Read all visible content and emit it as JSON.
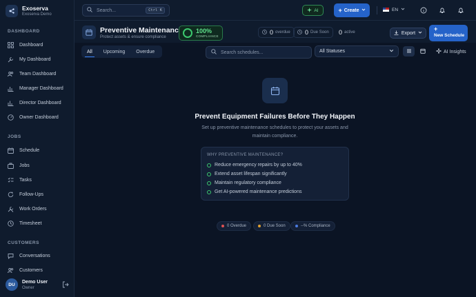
{
  "brand": {
    "name": "Exoserva",
    "subtitle": "Exoserva Demo"
  },
  "sidebar": {
    "sections": [
      {
        "label": "DASHBOARD",
        "items": [
          {
            "label": "Dashboard",
            "icon": "grid-icon"
          },
          {
            "label": "My Dashboard",
            "icon": "wrench-icon"
          },
          {
            "label": "Team Dashboard",
            "icon": "users-icon"
          },
          {
            "label": "Manager Dashboard",
            "icon": "bar-chart-icon"
          },
          {
            "label": "Director Dashboard",
            "icon": "bar-chart-icon"
          },
          {
            "label": "Owner Dashboard",
            "icon": "gauge-icon"
          }
        ]
      },
      {
        "label": "JOBS",
        "items": [
          {
            "label": "Schedule",
            "icon": "calendar-icon"
          },
          {
            "label": "Jobs",
            "icon": "briefcase-icon"
          },
          {
            "label": "Tasks",
            "icon": "tasks-icon"
          },
          {
            "label": "Follow-Ups",
            "icon": "refresh-icon"
          },
          {
            "label": "Work Orders",
            "icon": "wrench-icon"
          },
          {
            "label": "Timesheet",
            "icon": "clock-icon"
          }
        ]
      },
      {
        "label": "CUSTOMERS",
        "items": [
          {
            "label": "Conversations",
            "icon": "chat-icon"
          },
          {
            "label": "Customers",
            "icon": "users-icon"
          }
        ]
      }
    ]
  },
  "user": {
    "initials": "DU",
    "name": "Demo User",
    "role": "Owner"
  },
  "topbar": {
    "search_placeholder": "Search...",
    "search_shortcut": "Ctrl K",
    "ai_label": "AI",
    "create_label": "Create",
    "language": "EN"
  },
  "page": {
    "title": "Preventive Maintenance",
    "subtitle": "Protect assets & ensure compliance",
    "compliance_value": "100%",
    "compliance_label": "COMPLIANCE",
    "stats": [
      {
        "value": "0",
        "label": "overdue"
      },
      {
        "value": "0",
        "label": "Due Soon"
      },
      {
        "value": "0",
        "label": "active"
      }
    ],
    "export_label": "Export",
    "new_label": "New Schedule"
  },
  "filters": {
    "tabs": [
      "All",
      "Upcoming",
      "Overdue"
    ],
    "search_placeholder": "Search schedules...",
    "status_value": "All Statuses",
    "ai_insights": "AI Insights"
  },
  "empty": {
    "title": "Prevent Equipment Failures Before They Happen",
    "description": "Set up preventive maintenance schedules to protect your assets and maintain compliance.",
    "why_title": "WHY PREVENTIVE MAINTENANCE?",
    "reasons": [
      "Reduce emergency repairs by up to 40%",
      "Extend asset lifespan significantly",
      "Maintain regulatory compliance",
      "Get AI-powered maintenance predictions"
    ]
  },
  "footer_stats": [
    {
      "label": "0 Overdue",
      "color": "#e05252"
    },
    {
      "label": "0 Due Soon",
      "color": "#e0a030"
    },
    {
      "label": "--% Compliance",
      "color": "#4a7be0"
    }
  ]
}
